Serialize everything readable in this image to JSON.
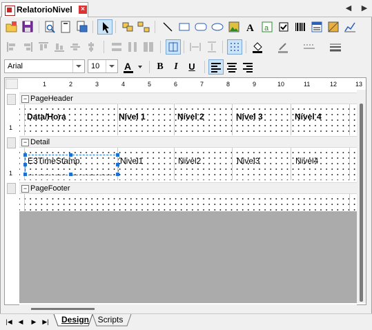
{
  "document_tab": {
    "title": "RelatorioNivel",
    "close": "×"
  },
  "nav_arrows": {
    "left": "◀",
    "right": "▶"
  },
  "toolbar1": {
    "icons": [
      "open-icon",
      "save-icon",
      "preview-icon",
      "page-setup-icon",
      "print-icon",
      "select-pointer-icon",
      "group-icon",
      "ungroup-icon",
      "line-icon",
      "rectangle-icon",
      "rounded-rectangle-icon",
      "ellipse-icon",
      "image-icon",
      "text-icon",
      "text-box-icon",
      "checkbox-icon",
      "barcode-icon",
      "subreport-icon",
      "shape-pattern-icon",
      "chart-icon"
    ]
  },
  "font": {
    "family": "Arial",
    "size": "10"
  },
  "format_buttons": {
    "bold": "B",
    "italic": "I",
    "underline": "U"
  },
  "ruler": {
    "marks": [
      "1",
      "2",
      "3",
      "4",
      "5",
      "6",
      "7",
      "8",
      "9",
      "10",
      "11",
      "12",
      "13"
    ]
  },
  "bands": {
    "page_header": {
      "label": "PageHeader",
      "collapse": "−"
    },
    "detail": {
      "label": "Detail",
      "collapse": "−"
    },
    "page_footer": {
      "label": "PageFooter",
      "collapse": "−"
    }
  },
  "header_cells": [
    "Data/Hora",
    "Nível 1",
    "Nível 2",
    "Nível 3",
    "Nível 4"
  ],
  "detail_cells": [
    "E3TimeStamp",
    "Nivel1",
    "Nivel2",
    "Nivel3",
    "Nivel4"
  ],
  "vruler_marks": [
    "1",
    "1"
  ],
  "bottom_tabs": {
    "design": "Design",
    "scripts": "Scripts"
  },
  "bottom_nav": {
    "first": "|◀",
    "prev": "◀",
    "next": "▶",
    "last": "▶|"
  }
}
